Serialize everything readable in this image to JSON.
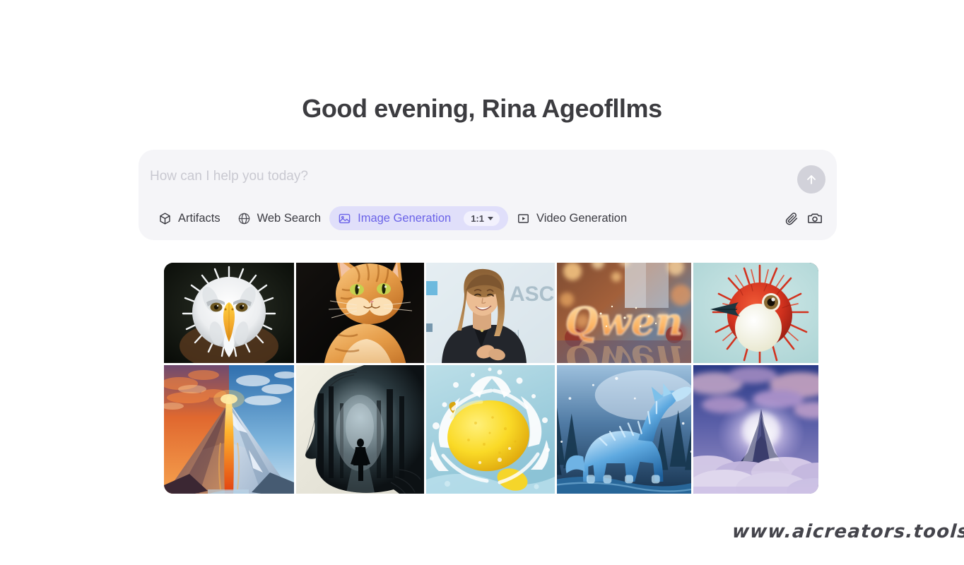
{
  "greeting": "Good evening, Rina Ageofllms",
  "composer": {
    "placeholder": "How can I help you today?",
    "send_label": "Send",
    "send_icon": "arrow-up-icon",
    "tools": [
      {
        "label": "Artifacts",
        "icon": "cube-icon",
        "active": false
      },
      {
        "label": "Web Search",
        "icon": "globe-icon",
        "active": false
      },
      {
        "label": "Image Generation",
        "icon": "image-icon",
        "active": true,
        "ratio": "1:1"
      },
      {
        "label": "Video Generation",
        "icon": "video-play-icon",
        "active": false
      }
    ],
    "right_icons": [
      {
        "name": "paperclip-icon",
        "label": "Attach file"
      },
      {
        "name": "camera-icon",
        "label": "Take photo"
      }
    ]
  },
  "accent": {
    "pill_bg": "#e0dffa",
    "pill_text": "#6b63e8",
    "card_bg": "#f5f5f8",
    "page_bg": "#ffffff",
    "title_color": "#3c3c40"
  },
  "gallery": {
    "columns": 5,
    "rows": 2,
    "items": [
      {
        "id": "eagle",
        "alt": "Bald eagle head close-up on dark background",
        "position": "col1-top"
      },
      {
        "id": "volcano",
        "alt": "Split fire and ice volcano mountain landscape",
        "position": "col1-bottom"
      },
      {
        "id": "cat",
        "alt": "Orange tabby cat portrait on black background",
        "position": "col2-top"
      },
      {
        "id": "silhouette",
        "alt": "Double exposure woman silhouette with walking man in forest",
        "position": "col2-bottom"
      },
      {
        "id": "speaker",
        "alt": "Smiling woman presenting on stage",
        "position": "col3-top"
      },
      {
        "id": "lemon",
        "alt": "Yellow lemon splashing into water",
        "position": "col3-bottom"
      },
      {
        "id": "qwen",
        "alt": "Glowing Qwen text made of lights with bokeh background",
        "position": "col4-top"
      },
      {
        "id": "wolf",
        "alt": "Blue ice wolf howling in snowy forest",
        "position": "col4-bottom"
      },
      {
        "id": "spikybird",
        "alt": "Red spiky bird creature on teal background",
        "position": "col5-top"
      },
      {
        "id": "cloudpeak",
        "alt": "Mystical glowing peak above purple clouds",
        "position": "col5-bottom"
      }
    ]
  },
  "watermark": "www.aicreators.tools"
}
